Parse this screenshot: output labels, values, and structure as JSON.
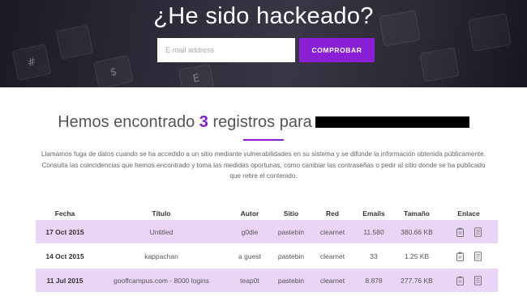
{
  "hero": {
    "title": "¿He sido hackeado?",
    "search": {
      "placeholder": "E-mail address",
      "value": ""
    },
    "button_label": "COMPROBAR"
  },
  "results": {
    "heading_prefix": "Hemos encontrado",
    "count": "3",
    "heading_suffix": "registros para",
    "description": "Llamamos fuga de datos cuando se ha accedido a un sitio mediante vulnerabilidades en su sistema y se difunde la información obtenida públicamente. Consulta las coincidencias que hemos encontrado y toma las medidas oportunas, como cambiar las contraseñas o pedir al sitio donde se ha publicado que retire el contenido."
  },
  "table": {
    "headers": {
      "fecha": "Fecha",
      "titulo": "Título",
      "autor": "Autor",
      "sitio": "Sitio",
      "red": "Red",
      "emails": "Emails",
      "tamano": "Tamaño",
      "enlace": "Enlace"
    },
    "rows": [
      {
        "fecha": "17 Oct 2015",
        "titulo": "Untitled",
        "autor": "g0die",
        "sitio": "pastebin",
        "red": "clearnet",
        "emails": "11.580",
        "tamano": "380.66 KB"
      },
      {
        "fecha": "14 Oct 2015",
        "titulo": "kappachan",
        "autor": "a guest",
        "sitio": "pastebin",
        "red": "clearnet",
        "emails": "33",
        "tamano": "1.25 KB"
      },
      {
        "fecha": "11 Jul 2015",
        "titulo": "gooffcampus.com - 8000 logins",
        "autor": "teap0t",
        "sitio": "pastebin",
        "red": "clearnet",
        "emails": "8.878",
        "tamano": "277.76 KB"
      }
    ],
    "row_icons": [
      "clipboard-icon",
      "document-icon"
    ]
  },
  "colors": {
    "accent": "#8a1fd6",
    "row_highlight": "#ead5f7",
    "hero_bg": "#2c2a38"
  }
}
